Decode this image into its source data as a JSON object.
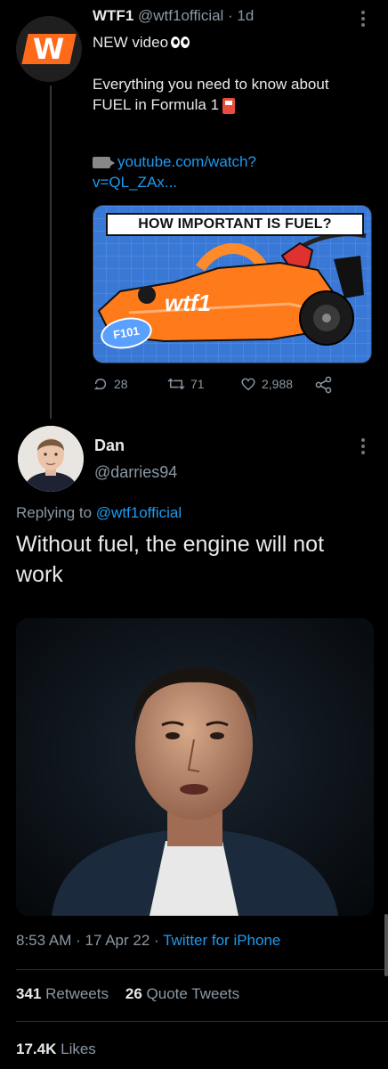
{
  "parent_tweet": {
    "display_name": "WTF1",
    "handle_time": "@wtf1official · 1d",
    "text_line1": "NEW video",
    "text_line2": "Everything you need to know about",
    "text_line3": "FUEL in Formula 1",
    "link_line1": "youtube.com/watch?",
    "link_line2": "v=QL_ZAx...",
    "thumbnail_title": "HOW IMPORTANT IS FUEL?",
    "thumbnail_brand": "wtf1",
    "thumbnail_badge": "F101",
    "replies": "28",
    "retweets": "71",
    "likes": "2,988"
  },
  "main_tweet": {
    "display_name": "Dan",
    "handle": "@darries94",
    "replying_prefix": "Replying to",
    "replying_to": "@wtf1official",
    "text": "Without fuel, the engine will not work",
    "time": "8:53 AM",
    "date": "17 Apr 22",
    "source": "Twitter for iPhone",
    "retweets_count": "341",
    "retweets_label": "Retweets",
    "quote_count": "26",
    "quote_label": "Quote Tweets",
    "likes_count": "17.4K",
    "likes_label": "Likes"
  },
  "colors": {
    "accent": "#1d9bf0",
    "background": "#000000",
    "brand_orange": "#ff6a1a"
  }
}
